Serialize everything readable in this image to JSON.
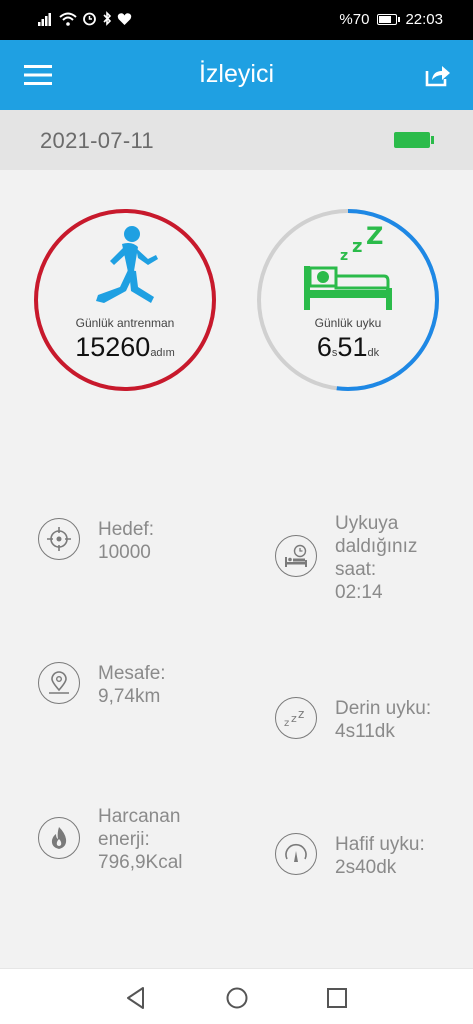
{
  "status_bar": {
    "battery_percent": "%70",
    "battery_level": 0.7,
    "time": "22:03",
    "icons": [
      "signal-icon",
      "wifi-icon",
      "alarm-icon",
      "bluetooth-icon",
      "heart-icon"
    ]
  },
  "app_bar": {
    "title": "İzleyici",
    "menu_icon": "hamburger-menu-icon",
    "share_icon": "share-icon"
  },
  "date_band": {
    "date": "2021-07-11",
    "device_battery_icon": "battery-full-icon",
    "device_battery_color": "#2bbb4a"
  },
  "activity_ring": {
    "label": "Günlük antrenman",
    "value": "15260",
    "unit": "adım",
    "color": "#c8192c",
    "progress": 1.0,
    "icon": "running-man-icon",
    "icon_color": "#1fa0e2"
  },
  "sleep_ring": {
    "label": "Günlük uyku",
    "hours": "6",
    "hours_unit": "s",
    "minutes": "51",
    "minutes_unit": "dk",
    "color": "#1e88e5",
    "track_color": "#d0d0d0",
    "progress": 0.52,
    "icon": "sleeping-bed-icon",
    "icon_color": "#2bbb4a"
  },
  "stats": {
    "goal": {
      "text": "Hedef:\n10000",
      "icon": "target-icon"
    },
    "distance": {
      "text": "Mesafe:\n9,74km",
      "icon": "location-pin-icon"
    },
    "energy": {
      "text": "Harcanan\nenerji:\n796,9Kcal",
      "icon": "flame-icon"
    },
    "sleep_time": {
      "text": "Uykuya\ndaldığınız\nsaat:\n02:14",
      "icon": "bed-clock-icon"
    },
    "deep_sleep": {
      "text": "Derin uyku:\n4s11dk",
      "icon": "zzz-icon"
    },
    "light_sleep": {
      "text": "Hafif uyku:\n2s40dk",
      "icon": "gauge-icon"
    }
  },
  "nav_bar": {
    "back_icon": "back-triangle-icon",
    "home_icon": "home-circle-icon",
    "recents_icon": "recents-square-icon"
  }
}
